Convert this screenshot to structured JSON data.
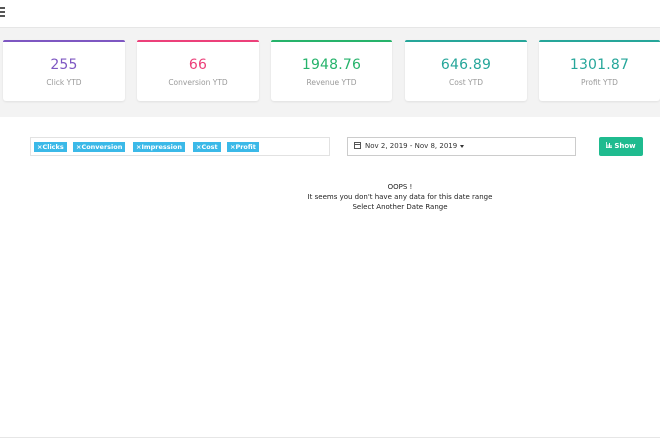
{
  "header": {
    "menu_icon": "hamburger-icon"
  },
  "stats": [
    {
      "value": "255",
      "label": "Click YTD",
      "color": "#7e57c2"
    },
    {
      "value": "66",
      "label": "Conversion YTD",
      "color": "#ec407a"
    },
    {
      "value": "1948.76",
      "label": "Revenue YTD",
      "color": "#26b36b"
    },
    {
      "value": "646.89",
      "label": "Cost YTD",
      "color": "#26a69a"
    },
    {
      "value": "1301.87",
      "label": "Profit YTD",
      "color": "#26a69a"
    }
  ],
  "filters": {
    "tags": [
      "×Clicks",
      "×Conversion",
      "×Impression",
      "×Cost",
      "×Profit"
    ],
    "tag_color": "#3bb9e8",
    "date_range": "Nov 2, 2019 - Nov 8, 2019",
    "show_label": "Show",
    "show_color": "#1fbb8f"
  },
  "message": {
    "line1": "OOPS !",
    "line2": "It seems you don't have any data for this date range",
    "line3": "Select Another Date Range"
  }
}
